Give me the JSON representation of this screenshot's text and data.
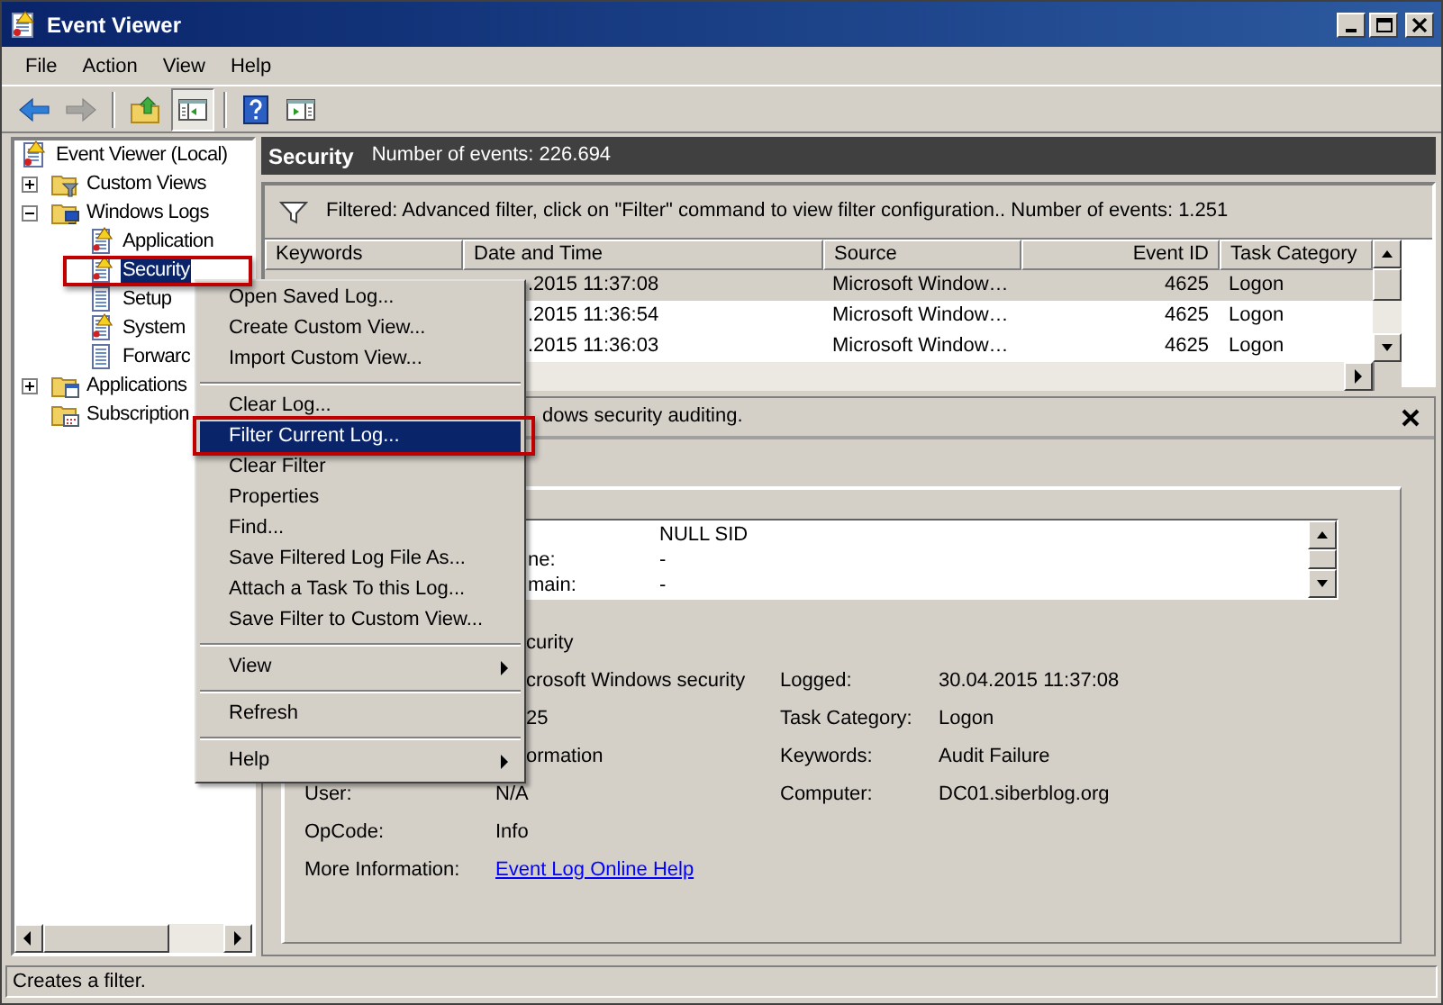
{
  "window": {
    "title": "Event Viewer"
  },
  "menu_bar": [
    {
      "label": "File"
    },
    {
      "label": "Action"
    },
    {
      "label": "View"
    },
    {
      "label": "Help"
    }
  ],
  "toolbar": [
    {
      "kind": "back",
      "disabled": false,
      "pressed": false
    },
    {
      "kind": "forward",
      "disabled": true,
      "pressed": false
    },
    {
      "kind": "separator"
    },
    {
      "kind": "up",
      "disabled": false,
      "pressed": false
    },
    {
      "kind": "console_tree",
      "disabled": false,
      "pressed": true
    },
    {
      "kind": "separator"
    },
    {
      "kind": "help",
      "disabled": false,
      "pressed": false
    },
    {
      "kind": "action_pane",
      "disabled": false,
      "pressed": false
    }
  ],
  "tree": [
    {
      "label": "Event Viewer (Local)",
      "kind": "root",
      "selected": false,
      "children": [
        {
          "label": "Custom Views",
          "kind": "filter_folder",
          "expanded": false,
          "selected": false
        },
        {
          "label": "Windows Logs",
          "kind": "logs_folder",
          "expanded": true,
          "selected": false,
          "children": [
            {
              "label": "Application",
              "kind": "log_alert",
              "selected": false
            },
            {
              "label": "Security",
              "kind": "log_alert",
              "selected": true
            },
            {
              "label": "Setup",
              "kind": "log",
              "selected": false
            },
            {
              "label": "System",
              "kind": "log_alert",
              "selected": false
            },
            {
              "label": "Forwarc",
              "kind": "log",
              "selected": false
            }
          ]
        },
        {
          "label": "Applications",
          "kind": "app_folder",
          "expanded": false,
          "selected": false
        },
        {
          "label": "Subscription",
          "kind": "subscription_folder",
          "selected": false
        }
      ]
    }
  ],
  "log_header": {
    "title": "Security",
    "count": "Number of events: 226.694"
  },
  "filter_bar": {
    "text": "Filtered: Advanced filter, click on \"Filter\" command to view filter configuration.. Number of events: 1.251"
  },
  "table": {
    "columns": [
      "Keywords",
      "Date and Time",
      "Source",
      "Event ID",
      "Task Category"
    ],
    "rows": [
      {
        "date": ".2015 11:37:08",
        "source": "Microsoft Window…",
        "event_id": "4625",
        "task_category": "Logon",
        "selected": true
      },
      {
        "date": ".2015 11:36:54",
        "source": "Microsoft Window…",
        "event_id": "4625",
        "task_category": "Logon",
        "selected": false
      },
      {
        "date": ".2015 11:36:03",
        "source": "Microsoft Window…",
        "event_id": "4625",
        "task_category": "Logon",
        "selected": false
      }
    ]
  },
  "detail": {
    "title": "dows security auditing.",
    "description": [
      {
        "value": "NULL SID"
      },
      {
        "label": "ne:",
        "value": "-"
      },
      {
        "label": "main:",
        "value": "-"
      }
    ],
    "fields": [
      {
        "kind": "text",
        "value": "curity"
      },
      {
        "kind": "text",
        "value": "crosoft Windows security",
        "label_2": "Logged:",
        "value_2": "30.04.2015 11:37:08"
      },
      {
        "kind": "text",
        "value": "25",
        "label_2": "Task Category:",
        "value_2": "Logon"
      },
      {
        "kind": "text",
        "value": "ormation",
        "label_2": "Keywords:",
        "value_2": "Audit Failure"
      },
      {
        "kind": "text",
        "label": "User:",
        "value": "N/A",
        "label_2": "Computer:",
        "value_2": "DC01.siberblog.org"
      },
      {
        "kind": "text",
        "label": "OpCode:",
        "value": "Info"
      },
      {
        "kind": "link",
        "label": "More Information:",
        "value": "Event Log Online Help"
      }
    ]
  },
  "context_menu": [
    {
      "kind": "item",
      "label": "Open Saved Log...",
      "selected": false
    },
    {
      "kind": "item",
      "label": "Create Custom View...",
      "selected": false
    },
    {
      "kind": "item",
      "label": "Import Custom View...",
      "selected": false
    },
    {
      "kind": "separator"
    },
    {
      "kind": "item",
      "label": "Clear Log...",
      "selected": false
    },
    {
      "kind": "item",
      "label": "Filter Current Log...",
      "selected": true
    },
    {
      "kind": "item",
      "label": "Clear Filter",
      "selected": false
    },
    {
      "kind": "item",
      "label": "Properties",
      "selected": false
    },
    {
      "kind": "item",
      "label": "Find...",
      "selected": false
    },
    {
      "kind": "item",
      "label": "Save Filtered Log File As...",
      "selected": false
    },
    {
      "kind": "item",
      "label": "Attach a Task To this Log...",
      "selected": false
    },
    {
      "kind": "item",
      "label": "Save Filter to Custom View...",
      "selected": false
    },
    {
      "kind": "separator"
    },
    {
      "kind": "submenu",
      "label": "View",
      "selected": false
    },
    {
      "kind": "separator"
    },
    {
      "kind": "item",
      "label": "Refresh",
      "selected": false
    },
    {
      "kind": "separator"
    },
    {
      "kind": "submenu",
      "label": "Help",
      "selected": false
    }
  ],
  "status_bar": {
    "text": "Creates a filter."
  }
}
